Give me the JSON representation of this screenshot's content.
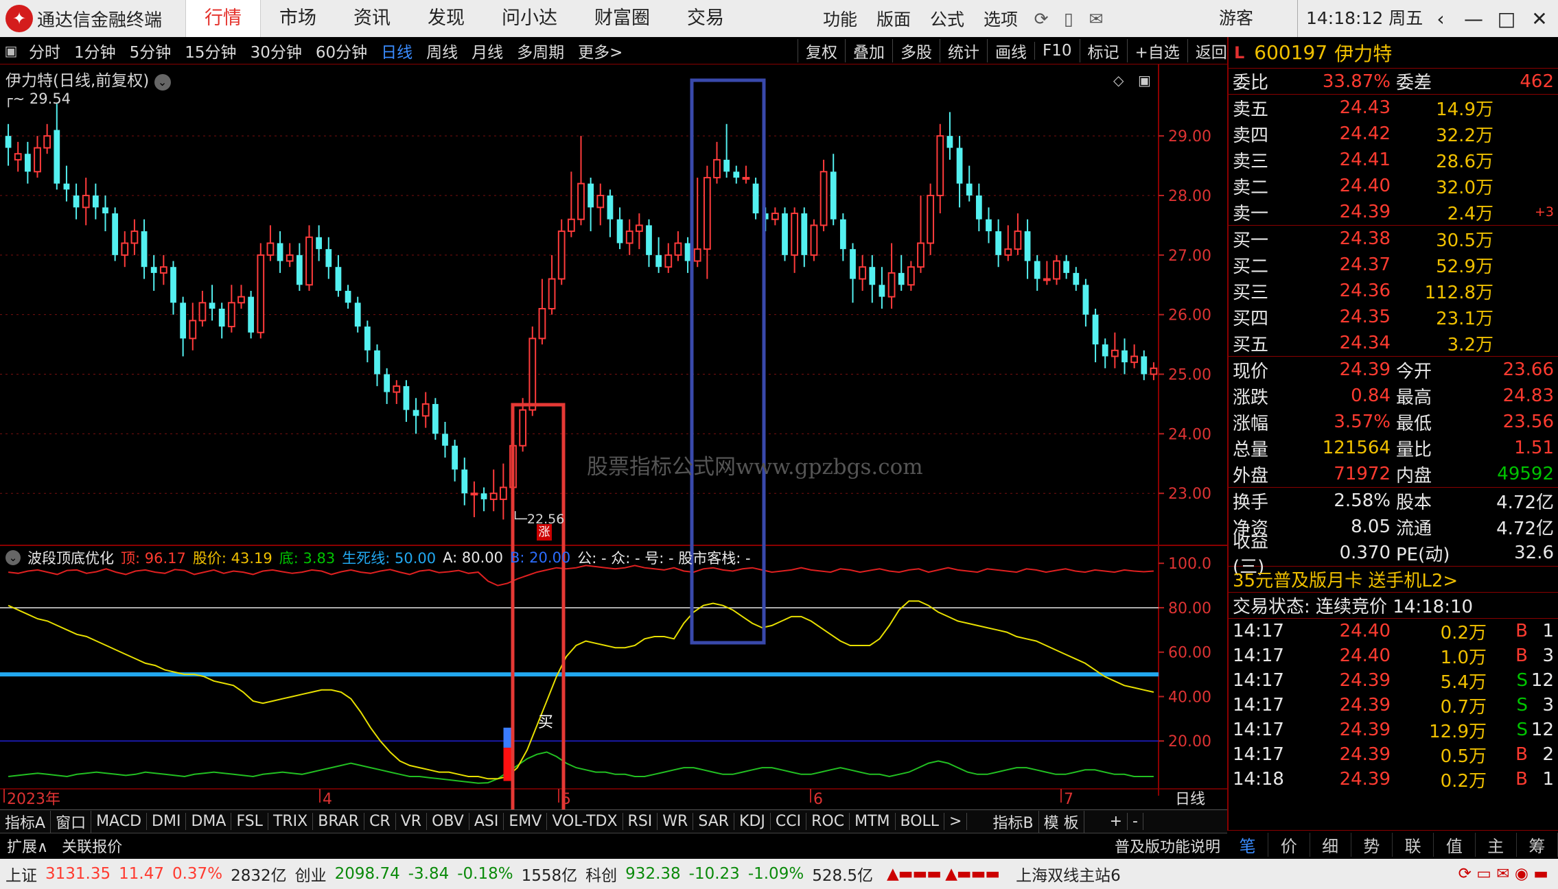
{
  "app": {
    "name": "通达信金融终端",
    "logo": "红色圆形标志",
    "clock": "14:18:12 周五",
    "guest": "游客"
  },
  "main_menu": [
    {
      "label": "行情",
      "active": true
    },
    {
      "label": "市场"
    },
    {
      "label": "资讯"
    },
    {
      "label": "发现"
    },
    {
      "label": "问小达"
    },
    {
      "label": "财富圈"
    },
    {
      "label": "交易"
    }
  ],
  "right_menu": [
    "功能",
    "版面",
    "公式",
    "选项"
  ],
  "period_tabs": [
    "分时",
    "1分钟",
    "5分钟",
    "15分钟",
    "30分钟",
    "60分钟",
    "日线",
    "周线",
    "月线",
    "多周期",
    "更多>"
  ],
  "active_period": "日线",
  "chart_tools": [
    "复权",
    "叠加",
    "多股",
    "统计",
    "画线",
    "F10",
    "标记",
    "+自选",
    "返回"
  ],
  "chart": {
    "title": "伊力特(日线,前复权)",
    "high_label": "29.54",
    "low_label": "22.56",
    "up_tag": "涨",
    "buy_tag": "买",
    "watermark": "股票指标公式网www.gpzbgs.com",
    "x_axis": [
      "2023年",
      "4",
      "5",
      "6",
      "7"
    ],
    "y_axis": [
      "29.00",
      "28.00",
      "27.00",
      "26.00",
      "25.00",
      "24.00",
      "23.00"
    ],
    "ind_axis": [
      "100.0",
      "80.00",
      "60.00",
      "40.00",
      "20.00"
    ],
    "period_label": "日线"
  },
  "chart_data": {
    "type": "candlestick",
    "title": "伊力特(日线,前复权)",
    "ylim": [
      22.3,
      29.9
    ],
    "x": [
      "2023年",
      "4",
      "5",
      "6",
      "7"
    ],
    "candles": [
      [
        29.0,
        28.8,
        29.2,
        28.5
      ],
      [
        28.6,
        28.7,
        28.9,
        28.4
      ],
      [
        28.7,
        28.4,
        28.9,
        28.2
      ],
      [
        28.4,
        28.8,
        29.0,
        28.3
      ],
      [
        28.8,
        29.0,
        29.2,
        28.7
      ],
      [
        29.1,
        28.2,
        29.54,
        28.1
      ],
      [
        28.2,
        28.1,
        28.5,
        27.9
      ],
      [
        28.0,
        27.8,
        28.2,
        27.6
      ],
      [
        27.8,
        28.0,
        28.3,
        27.5
      ],
      [
        28.0,
        27.8,
        28.2,
        27.6
      ],
      [
        27.8,
        27.7,
        28.0,
        27.4
      ],
      [
        27.7,
        27.0,
        27.8,
        26.9
      ],
      [
        27.0,
        27.2,
        27.4,
        26.8
      ],
      [
        27.2,
        27.4,
        27.6,
        27.0
      ],
      [
        27.4,
        26.8,
        27.6,
        26.6
      ],
      [
        26.8,
        26.7,
        27.0,
        26.4
      ],
      [
        26.7,
        26.8,
        27.0,
        26.5
      ],
      [
        26.8,
        26.2,
        26.9,
        26.0
      ],
      [
        26.2,
        25.6,
        26.3,
        25.3
      ],
      [
        25.6,
        25.9,
        26.2,
        25.4
      ],
      [
        25.9,
        26.2,
        26.4,
        25.8
      ],
      [
        26.2,
        26.1,
        26.5,
        25.9
      ],
      [
        26.1,
        25.8,
        26.2,
        25.6
      ],
      [
        25.8,
        26.2,
        26.5,
        25.7
      ],
      [
        26.2,
        26.3,
        26.5,
        26.1
      ],
      [
        26.3,
        25.7,
        26.4,
        25.6
      ],
      [
        25.7,
        27.0,
        27.2,
        25.6
      ],
      [
        27.0,
        27.2,
        27.5,
        26.9
      ],
      [
        27.2,
        26.9,
        27.4,
        26.7
      ],
      [
        26.9,
        27.0,
        27.2,
        26.8
      ],
      [
        27.0,
        26.5,
        27.2,
        26.4
      ],
      [
        26.5,
        27.3,
        27.5,
        26.4
      ],
      [
        27.3,
        27.1,
        27.5,
        26.9
      ],
      [
        27.1,
        26.8,
        27.3,
        26.6
      ],
      [
        26.8,
        26.4,
        27.0,
        26.3
      ],
      [
        26.4,
        26.2,
        26.5,
        26.1
      ],
      [
        26.2,
        25.8,
        26.3,
        25.7
      ],
      [
        25.8,
        25.4,
        25.9,
        25.2
      ],
      [
        25.4,
        25.0,
        25.5,
        24.8
      ],
      [
        25.0,
        24.7,
        25.1,
        24.5
      ],
      [
        24.7,
        24.8,
        24.9,
        24.5
      ],
      [
        24.8,
        24.4,
        24.9,
        24.2
      ],
      [
        24.4,
        24.3,
        24.6,
        24.0
      ],
      [
        24.3,
        24.5,
        24.7,
        24.1
      ],
      [
        24.5,
        24.0,
        24.6,
        23.9
      ],
      [
        24.0,
        23.8,
        24.2,
        23.6
      ],
      [
        23.8,
        23.4,
        23.9,
        23.2
      ],
      [
        23.4,
        23.0,
        23.6,
        22.8
      ],
      [
        23.0,
        23.0,
        23.2,
        22.6
      ],
      [
        23.0,
        22.9,
        23.1,
        22.7
      ],
      [
        22.9,
        23.0,
        23.4,
        22.7
      ],
      [
        22.9,
        23.1,
        23.5,
        22.56
      ],
      [
        23.1,
        23.8,
        24.1,
        23.0
      ],
      [
        23.8,
        24.4,
        24.6,
        23.7
      ],
      [
        24.4,
        25.6,
        25.8,
        24.3
      ],
      [
        25.6,
        26.1,
        26.6,
        25.5
      ],
      [
        26.1,
        26.6,
        27.0,
        26.0
      ],
      [
        26.6,
        27.4,
        27.6,
        26.5
      ],
      [
        27.4,
        27.6,
        28.4,
        27.3
      ],
      [
        27.6,
        28.2,
        29.0,
        27.5
      ],
      [
        28.2,
        27.8,
        28.3,
        27.4
      ],
      [
        27.8,
        28.0,
        28.2,
        27.5
      ],
      [
        28.0,
        27.6,
        28.1,
        27.3
      ],
      [
        27.6,
        27.2,
        27.8,
        27.1
      ],
      [
        27.2,
        27.4,
        27.6,
        27.0
      ],
      [
        27.4,
        27.5,
        27.7,
        27.1
      ],
      [
        27.5,
        27.0,
        27.6,
        26.8
      ],
      [
        27.0,
        26.8,
        27.3,
        26.7
      ],
      [
        26.8,
        27.0,
        27.2,
        26.7
      ],
      [
        27.0,
        27.2,
        27.4,
        26.9
      ],
      [
        27.2,
        26.9,
        27.3,
        26.7
      ],
      [
        26.9,
        27.1,
        28.3,
        26.8
      ],
      [
        27.1,
        28.3,
        28.5,
        26.6
      ],
      [
        28.3,
        28.6,
        28.9,
        28.2
      ],
      [
        28.6,
        28.4,
        29.2,
        28.3
      ],
      [
        28.4,
        28.3,
        28.5,
        28.2
      ],
      [
        28.3,
        28.3,
        28.5,
        28.2
      ],
      [
        28.2,
        27.7,
        28.3,
        27.6
      ],
      [
        27.7,
        27.6,
        27.8,
        27.4
      ],
      [
        27.6,
        27.7,
        27.8,
        27.5
      ],
      [
        27.7,
        27.0,
        27.8,
        26.9
      ],
      [
        27.0,
        27.7,
        27.8,
        26.7
      ],
      [
        27.7,
        27.0,
        27.8,
        26.8
      ],
      [
        27.0,
        27.5,
        27.6,
        26.9
      ],
      [
        27.5,
        28.4,
        28.6,
        27.4
      ],
      [
        28.4,
        27.6,
        28.7,
        27.5
      ],
      [
        27.6,
        27.1,
        27.7,
        26.9
      ],
      [
        27.1,
        26.6,
        27.2,
        26.2
      ],
      [
        26.6,
        26.8,
        27.0,
        26.4
      ],
      [
        26.8,
        26.5,
        27.0,
        26.2
      ],
      [
        26.5,
        26.3,
        26.8,
        26.1
      ],
      [
        26.3,
        26.7,
        27.2,
        26.1
      ],
      [
        26.7,
        26.5,
        27.0,
        26.4
      ],
      [
        26.5,
        26.8,
        26.9,
        26.4
      ],
      [
        26.8,
        27.2,
        28.0,
        26.7
      ],
      [
        27.2,
        28.0,
        28.2,
        27.0
      ],
      [
        28.0,
        29.0,
        29.2,
        27.7
      ],
      [
        29.0,
        28.8,
        29.4,
        28.6
      ],
      [
        28.8,
        28.2,
        29.0,
        27.8
      ],
      [
        28.2,
        28.0,
        28.5,
        27.9
      ],
      [
        28.0,
        27.6,
        28.2,
        27.4
      ],
      [
        27.6,
        27.4,
        27.8,
        27.2
      ],
      [
        27.4,
        27.0,
        27.6,
        26.8
      ],
      [
        27.0,
        27.1,
        27.5,
        26.9
      ],
      [
        27.1,
        27.4,
        27.7,
        27.0
      ],
      [
        27.4,
        26.9,
        27.6,
        26.6
      ],
      [
        26.9,
        26.6,
        27.0,
        26.4
      ],
      [
        26.6,
        26.6,
        26.9,
        26.5
      ],
      [
        26.6,
        26.9,
        27.0,
        26.5
      ],
      [
        26.9,
        26.7,
        27.0,
        26.6
      ],
      [
        26.7,
        26.5,
        26.8,
        26.4
      ],
      [
        26.5,
        26.0,
        26.6,
        25.8
      ],
      [
        26.0,
        25.5,
        26.1,
        25.2
      ],
      [
        25.5,
        25.3,
        25.6,
        25.1
      ],
      [
        25.3,
        25.4,
        25.7,
        25.1
      ],
      [
        25.4,
        25.2,
        25.6,
        25.0
      ],
      [
        25.2,
        25.3,
        25.5,
        25.1
      ],
      [
        25.3,
        25.0,
        25.4,
        24.9
      ],
      [
        25.0,
        25.1,
        25.2,
        24.9
      ]
    ],
    "indicator": {
      "name": "波段顶底优化",
      "ylim": [
        0,
        105
      ],
      "top": [
        96.0,
        95.5,
        96.5,
        97.0,
        96.0,
        95.0,
        96.8,
        97.0,
        95.5,
        96.2,
        97.5,
        96.0,
        95.0,
        96.5,
        97.0,
        96.0,
        95.5,
        97.2,
        96.8,
        95.0,
        96.0,
        97.0,
        95.5,
        96.5,
        96.0,
        95.0,
        96.5,
        97.0,
        96.2,
        95.5,
        96.0,
        97.0,
        96.5,
        95.0,
        96.2,
        97.0,
        96.0,
        95.5,
        96.5,
        97.2,
        96.0,
        95.0,
        96.5,
        97.0,
        95.8,
        96.2,
        96.8,
        95.5,
        96.0,
        92.0,
        90.0,
        91.0,
        93.0,
        94.5,
        96.0,
        97.0,
        98.0,
        97.5,
        98.0,
        99.0,
        98.5,
        98.0,
        97.5,
        98.0,
        99.0,
        98.0,
        97.5,
        97.0,
        98.0,
        96.5,
        96.0,
        97.5,
        98.0,
        97.0,
        96.5,
        97.5,
        98.0,
        97.0,
        96.0,
        96.5,
        97.0,
        98.0,
        97.0,
        96.5,
        96.0,
        97.5,
        97.0,
        96.0,
        96.8,
        97.5,
        96.5,
        96.0,
        97.0,
        97.5,
        96.0,
        97.0,
        98.0,
        97.0,
        96.5,
        96.0,
        97.5,
        97.0,
        96.5,
        96.0,
        97.5,
        97.0,
        96.0,
        96.8,
        97.5,
        96.5,
        96.0,
        97.0,
        96.5,
        96.0,
        97.0,
        96.5,
        96.2,
        96.5
      ],
      "price": [
        81,
        79,
        77,
        75,
        74,
        72,
        70,
        68,
        67,
        65,
        63,
        61,
        59,
        57,
        55,
        54,
        52,
        51,
        50,
        50,
        49,
        47,
        46,
        45,
        42,
        38,
        37,
        38,
        39,
        40,
        41,
        42,
        43,
        43,
        42,
        39,
        33,
        26,
        20,
        15,
        11,
        9,
        8,
        7,
        6,
        6,
        5,
        4,
        4,
        3,
        3,
        4,
        8,
        16,
        27,
        38,
        49,
        58,
        63,
        65,
        64,
        63,
        62,
        62,
        63,
        66,
        67,
        67,
        66,
        73,
        78,
        81,
        82,
        81,
        79,
        76,
        73,
        71,
        72,
        74,
        76,
        76,
        74,
        71,
        68,
        65,
        63,
        63,
        63,
        66,
        72,
        79,
        83,
        83,
        81,
        78,
        76,
        74,
        73,
        72,
        71,
        70,
        69,
        67,
        66,
        65,
        63,
        61,
        59,
        57,
        55,
        52,
        49,
        47,
        45,
        44,
        43,
        42
      ],
      "bottom": [
        4,
        4.5,
        5,
        5.5,
        5,
        4.5,
        4,
        5,
        5.5,
        6,
        5.5,
        5,
        4.5,
        5,
        6,
        5.5,
        5,
        4.5,
        4,
        5,
        5.5,
        6,
        5.5,
        5,
        4.5,
        4,
        5,
        5.5,
        6,
        5.5,
        5,
        6,
        7,
        8,
        9,
        10,
        9,
        8,
        7,
        6,
        5,
        4,
        4,
        3.5,
        3,
        2.5,
        2,
        1.5,
        1,
        1.2,
        3,
        6,
        9,
        12,
        14,
        15,
        13,
        10,
        8,
        7,
        6,
        6,
        5,
        5,
        4,
        4,
        5,
        6,
        7,
        8,
        8,
        7,
        6,
        5,
        5,
        6,
        7,
        8,
        8,
        7,
        6,
        5,
        5,
        6,
        7,
        8,
        7,
        6,
        5,
        5,
        4,
        5,
        6,
        8,
        10,
        11,
        10,
        8,
        6,
        5,
        5,
        6,
        7,
        8,
        8,
        7,
        6,
        5,
        5,
        6,
        7,
        7,
        6,
        5,
        5,
        4,
        4,
        4
      ],
      "labels": {
        "top": "顶: 96.17",
        "price": "股价: 43.19",
        "bottom": "底: 3.83",
        "life": "生死线: 50.00",
        "a": "A: 80.00",
        "b": "B: 20.00",
        "extra": "公: -  众: -  号: -  股市客栈: -"
      }
    }
  },
  "panel": {
    "level": "L",
    "code": "600197",
    "name": "伊力特",
    "webi": {
      "label": "委比",
      "value": "33.87%",
      "label2": "委差",
      "value2": "462"
    },
    "sell": [
      {
        "l": "卖五",
        "p": "24.43",
        "v": "14.9万"
      },
      {
        "l": "卖四",
        "p": "24.42",
        "v": "32.2万"
      },
      {
        "l": "卖三",
        "p": "24.41",
        "v": "28.6万"
      },
      {
        "l": "卖二",
        "p": "24.40",
        "v": "32.0万"
      },
      {
        "l": "卖一",
        "p": "24.39",
        "v": "2.4万",
        "d": "+3"
      }
    ],
    "buy": [
      {
        "l": "买一",
        "p": "24.38",
        "v": "30.5万"
      },
      {
        "l": "买二",
        "p": "24.37",
        "v": "52.9万"
      },
      {
        "l": "买三",
        "p": "24.36",
        "v": "112.8万"
      },
      {
        "l": "买四",
        "p": "24.35",
        "v": "23.1万"
      },
      {
        "l": "买五",
        "p": "24.34",
        "v": "3.2万"
      }
    ],
    "quote": [
      {
        "l1": "现价",
        "v1": "24.39",
        "l2": "今开",
        "v2": "23.66"
      },
      {
        "l1": "涨跌",
        "v1": "0.84",
        "l2": "最高",
        "v2": "24.83"
      },
      {
        "l1": "涨幅",
        "v1": "3.57%",
        "l2": "最低",
        "v2": "23.56"
      },
      {
        "l1": "总量",
        "v1": "121564",
        "l2": "量比",
        "v2": "1.51"
      },
      {
        "l1": "外盘",
        "v1": "71972",
        "l2": "内盘",
        "v2": "49592"
      }
    ],
    "finance": [
      {
        "l1": "换手",
        "v1": "2.58%",
        "l2": "股本",
        "v2": "4.72亿"
      },
      {
        "l1": "净资",
        "v1": "8.05",
        "l2": "流通",
        "v2": "4.72亿"
      },
      {
        "l1": "收益(三)",
        "v1": "0.370",
        "l2": "PE(动)",
        "v2": "32.6"
      }
    ],
    "promo": "35元普及版月卡 送手机L2>",
    "status": "交易状态: 连续竞价 14:18:10",
    "ticks": [
      {
        "t": "14:17",
        "p": "24.40",
        "v": "0.2万",
        "s": "B",
        "n": "1"
      },
      {
        "t": "14:17",
        "p": "24.40",
        "v": "1.0万",
        "s": "B",
        "n": "3"
      },
      {
        "t": "14:17",
        "p": "24.39",
        "v": "5.4万",
        "s": "S",
        "n": "12"
      },
      {
        "t": "14:17",
        "p": "24.39",
        "v": "0.7万",
        "s": "S",
        "n": "3"
      },
      {
        "t": "14:17",
        "p": "24.39",
        "v": "12.9万",
        "s": "S",
        "n": "12"
      },
      {
        "t": "14:17",
        "p": "24.39",
        "v": "0.5万",
        "s": "B",
        "n": "2"
      },
      {
        "t": "14:18",
        "p": "24.39",
        "v": "0.2万",
        "s": "B",
        "n": "1"
      }
    ],
    "tabs": [
      "笔",
      "价",
      "细",
      "势",
      "联",
      "值",
      "主",
      "筹"
    ]
  },
  "indicator_tabs": [
    "指标A",
    "窗口",
    "MACD",
    "DMI",
    "DMA",
    "FSL",
    "TRIX",
    "BRAR",
    "CR",
    "VR",
    "OBV",
    "ASI",
    "EMV",
    "VOL-TDX",
    "RSI",
    "WR",
    "SAR",
    "KDJ",
    "CCI",
    "ROC",
    "MTM",
    "BOLL",
    ">",
    "指标B",
    "模 板",
    "+",
    "-"
  ],
  "ext_bar": {
    "left": "扩展∧",
    "link": "关联报价",
    "right": "普及版功能说明"
  },
  "status_bar": {
    "sh_label": "上证",
    "sh": "3131.35",
    "sh_chg": "11.47",
    "sh_pct": "0.37%",
    "sh_amt": "2832亿",
    "cy_label": "创业",
    "cy": "2098.74",
    "cy_chg": "-3.84",
    "cy_pct": "-0.18%",
    "cy_amt": "1558亿",
    "kc_label": "科创",
    "kc": "932.38",
    "kc_chg": "-10.23",
    "kc_pct": "-1.09%",
    "kc_amt": "528.5亿",
    "server": "上海双线主站6"
  }
}
